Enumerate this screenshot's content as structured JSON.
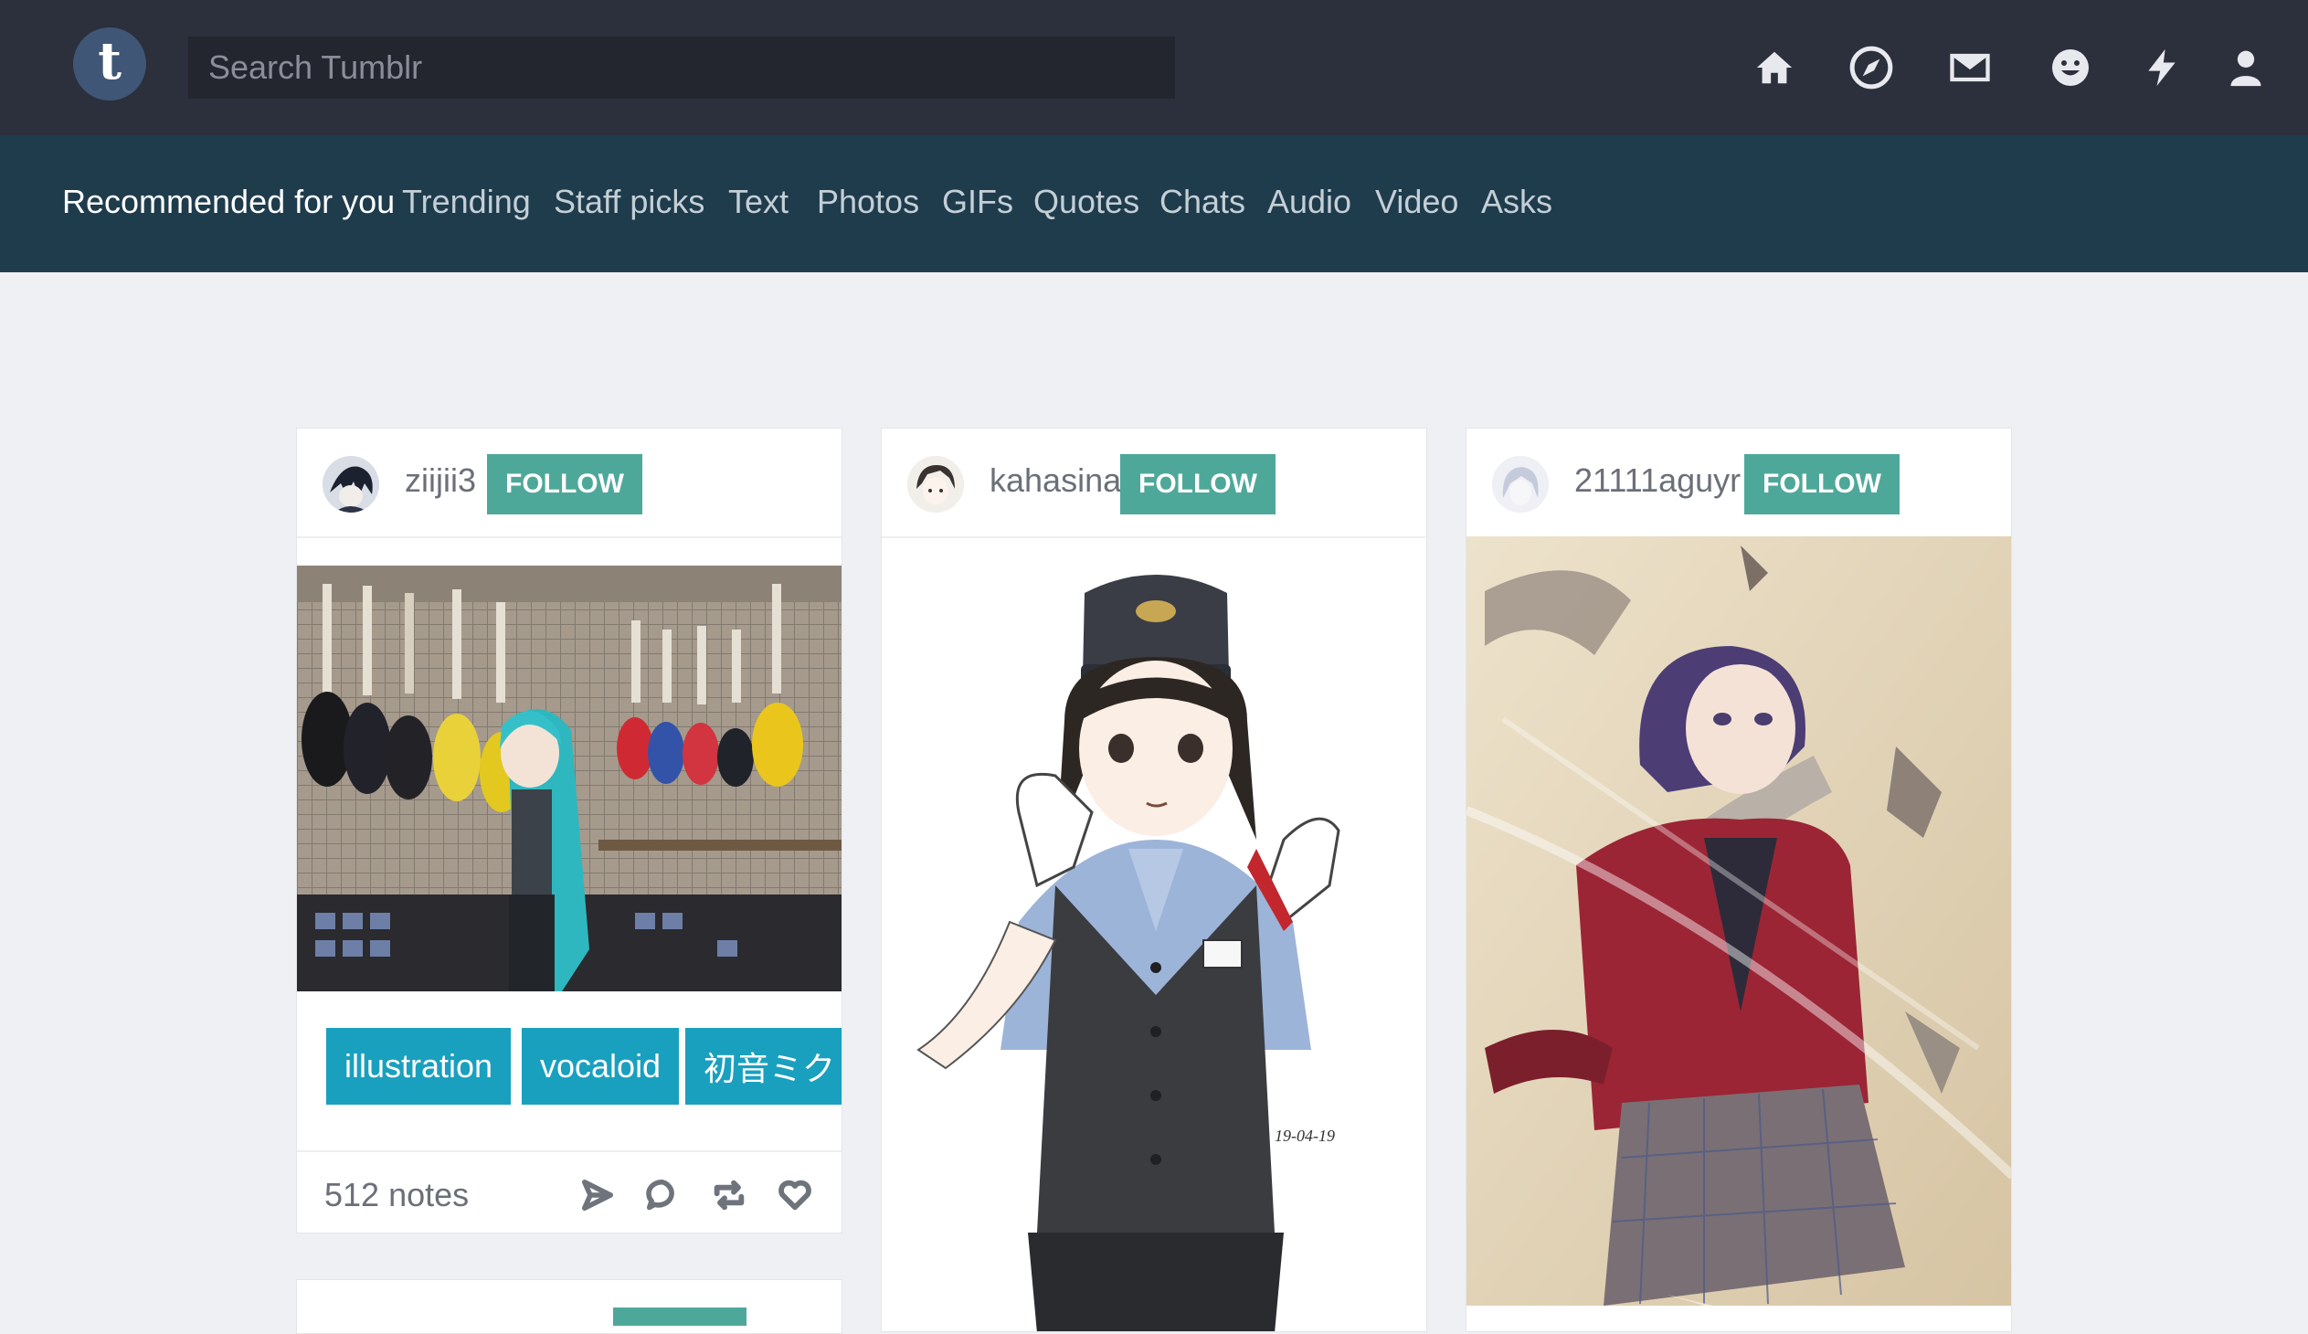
{
  "header": {
    "logo_letter": "t",
    "search_placeholder": "Search Tumblr",
    "icons": [
      "home-icon",
      "explore-compass-icon",
      "inbox-mail-icon",
      "messaging-smiley-icon",
      "activity-lightning-icon",
      "account-person-icon"
    ]
  },
  "explore_tabs": [
    {
      "label": "Recommended for you",
      "active": true
    },
    {
      "label": "Trending"
    },
    {
      "label": "Staff picks"
    },
    {
      "label": "Text"
    },
    {
      "label": "Photos"
    },
    {
      "label": "GIFs"
    },
    {
      "label": "Quotes"
    },
    {
      "label": "Chats"
    },
    {
      "label": "Audio"
    },
    {
      "label": "Video"
    },
    {
      "label": "Asks"
    }
  ],
  "posts": [
    {
      "username": "ziijii3",
      "follow_label": "FOLLOW",
      "tags": [
        "illustration",
        "vocaloid",
        "初音ミク"
      ],
      "notes": "512 notes"
    },
    {
      "username": "kahasina",
      "follow_label": "FOLLOW"
    },
    {
      "username": "21111aguyr",
      "follow_label": "FOLLOW"
    }
  ],
  "colors": {
    "topbar": "#2c2f3c",
    "tabsbar": "#1f3c4d",
    "follow": "#4ea89a",
    "tag": "#1aa0bf",
    "background": "#eef0f3"
  }
}
